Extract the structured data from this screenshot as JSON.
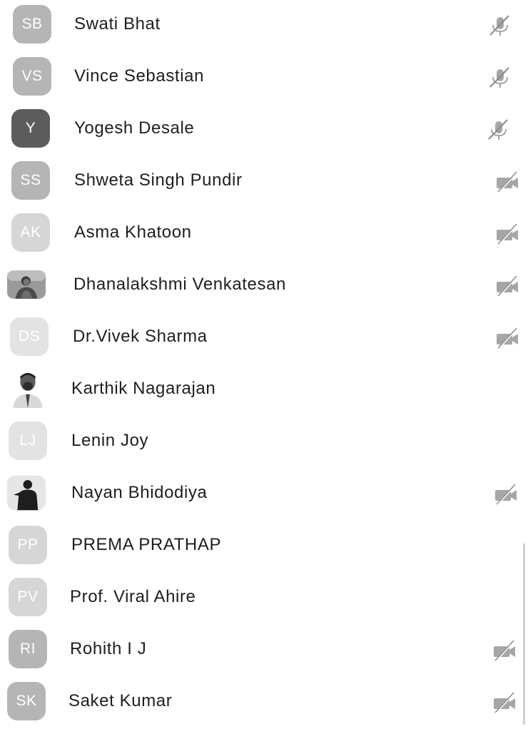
{
  "participants": [
    {
      "name": "Swati Bhat",
      "initials": "SB",
      "status_icon": "mic-muted-icon"
    },
    {
      "name": "Vince Sebastian",
      "initials": "VS",
      "status_icon": "mic-muted-icon"
    },
    {
      "name": "Yogesh Desale",
      "initials": "Y",
      "status_icon": "mic-muted-icon"
    },
    {
      "name": "Shweta Singh Pundir",
      "initials": "SS",
      "status_icon": "video-off-icon"
    },
    {
      "name": "Asma Khatoon",
      "initials": "AK",
      "status_icon": "video-off-icon"
    },
    {
      "name": "Dhanalakshmi Venkatesan",
      "initials": "",
      "avatar": "photo",
      "status_icon": "video-off-icon"
    },
    {
      "name": "Dr.Vivek Sharma",
      "initials": "DS",
      "status_icon": "video-off-icon"
    },
    {
      "name": "Karthik Nagarajan",
      "initials": "",
      "avatar": "photo",
      "status_icon": ""
    },
    {
      "name": "Lenin Joy",
      "initials": "LJ",
      "status_icon": ""
    },
    {
      "name": "Nayan Bhidodiya",
      "initials": "",
      "avatar": "photo",
      "status_icon": "video-off-icon"
    },
    {
      "name": "PREMA PRATHAP",
      "initials": "PP",
      "status_icon": ""
    },
    {
      "name": "Prof. Viral Ahire",
      "initials": "PV",
      "status_icon": ""
    },
    {
      "name": "Rohith I J",
      "initials": "RI",
      "status_icon": "video-off-icon"
    },
    {
      "name": "Saket Kumar",
      "initials": "SK",
      "status_icon": "video-off-icon"
    }
  ]
}
